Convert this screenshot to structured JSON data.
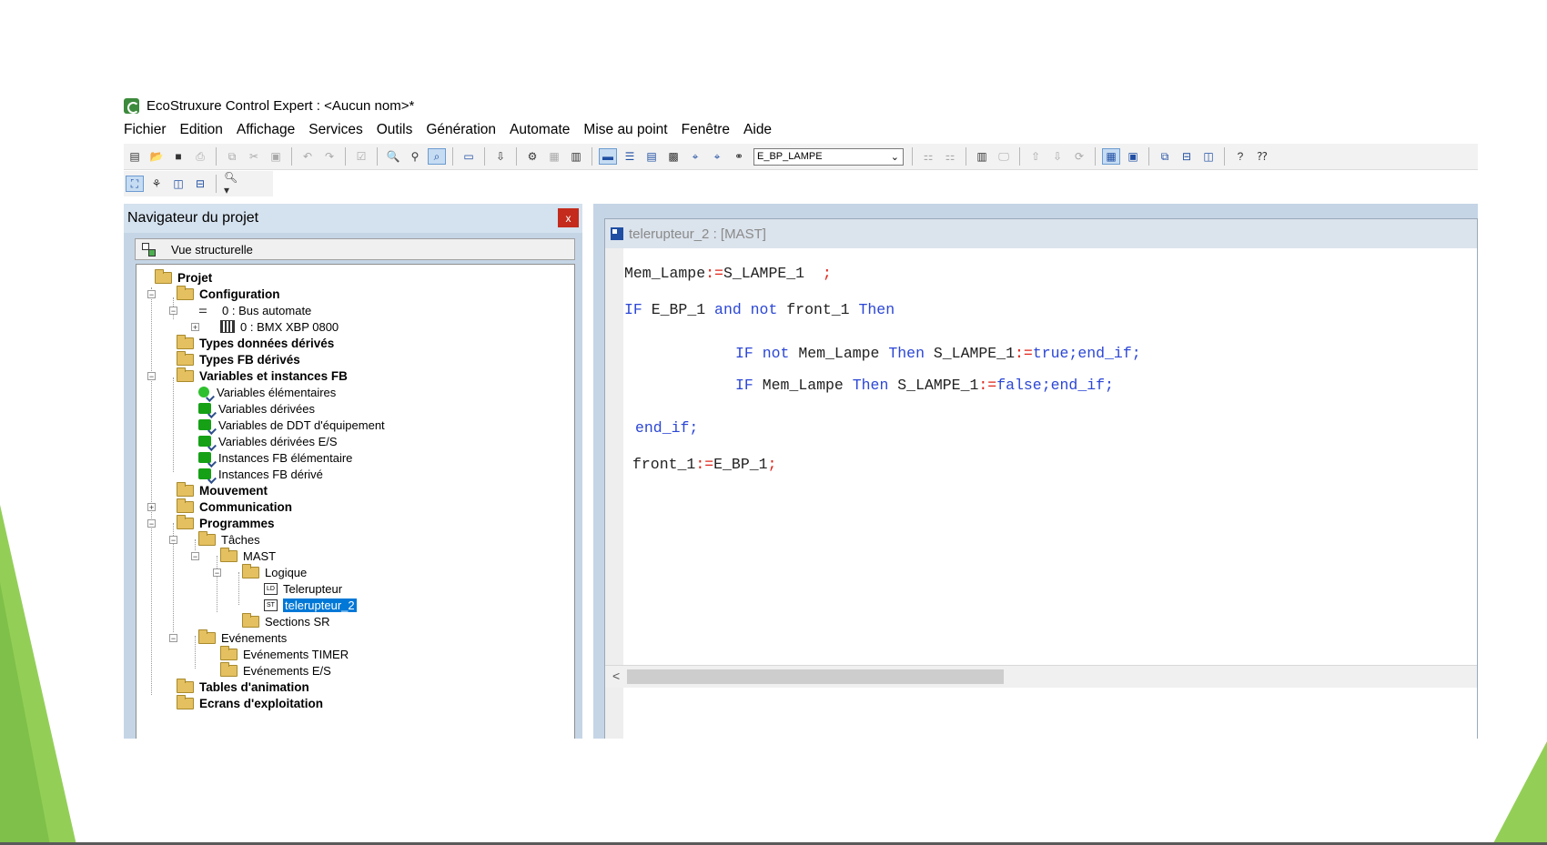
{
  "app": {
    "title": "EcoStruxure Control Expert : <Aucun nom>*"
  },
  "menu": [
    "Fichier",
    "Edition",
    "Affichage",
    "Services",
    "Outils",
    "Génération",
    "Automate",
    "Mise au point",
    "Fenêtre",
    "Aide"
  ],
  "toolbar": {
    "variable_combo_value": "E_BP_LAMPE"
  },
  "navigator": {
    "title": "Navigateur du projet",
    "close_label": "x",
    "view_label": "Vue structurelle",
    "tree": {
      "projet": "Projet",
      "configuration": "Configuration",
      "bus": "0 : Bus automate",
      "module": "0 : BMX XBP 0800",
      "types_ddt": "Types données dérivés",
      "types_fb": "Types FB dérivés",
      "variables": "Variables et instances FB",
      "var_elem": "Variables élémentaires",
      "var_deriv": "Variables dérivées",
      "var_ddt": "Variables de DDT d'équipement",
      "var_es": "Variables dérivées E/S",
      "fb_elem": "Instances FB élémentaire",
      "fb_deriv": "Instances FB dérivé",
      "mouvement": "Mouvement",
      "communication": "Communication",
      "programmes": "Programmes",
      "taches": "Tâches",
      "mast": "MAST",
      "logique": "Logique",
      "telerupteur": "Telerupteur",
      "telerupteur2": "telerupteur_2",
      "sections_sr": "Sections SR",
      "evenements": "Evénements",
      "ev_timer": "Evénements TIMER",
      "ev_es": "Evénements E/S",
      "tables_anim": "Tables d'animation",
      "ecrans": "Ecrans d'exploitation"
    }
  },
  "editor": {
    "title": "telerupteur_2 : [MAST]",
    "code": {
      "l1_a": "Mem_Lampe",
      "l1_b": ":=",
      "l1_c": "S_LAMPE_1",
      "l1_d": ";",
      "l2_a": "IF",
      "l2_b": "E_BP_1",
      "l2_c": "and not",
      "l2_d": "front_1",
      "l2_e": "Then",
      "l3_a": "IF not",
      "l3_b": "Mem_Lampe",
      "l3_c": "Then",
      "l3_d": "S_LAMPE_1",
      "l3_e": ":=",
      "l3_f": "true;end_if;",
      "l4_a": "IF",
      "l4_b": "Mem_Lampe",
      "l4_c": "Then",
      "l4_d": "S_LAMPE_1",
      "l4_e": ":=",
      "l4_f": "false;end_if;",
      "l5": "end_if;",
      "l6_a": "front_1",
      "l6_b": ":=",
      "l6_c": "E_BP_1",
      "l6_d": ";"
    }
  },
  "colors": {
    "keyword": "#2b46d6",
    "operator": "#e0251a",
    "slide_accent": "#8fcf55"
  }
}
